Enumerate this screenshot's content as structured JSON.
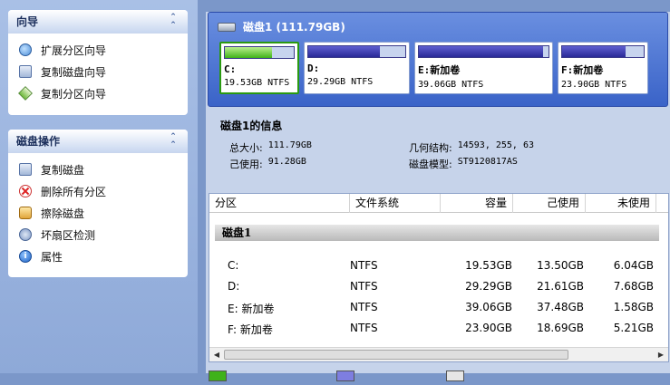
{
  "sidebar": {
    "wizards": {
      "title": "向导",
      "items": [
        {
          "label": "扩展分区向导",
          "icon": "expand-partition-icon"
        },
        {
          "label": "复制磁盘向导",
          "icon": "copy-disk-icon"
        },
        {
          "label": "复制分区向导",
          "icon": "copy-partition-icon"
        }
      ]
    },
    "disk_ops": {
      "title": "磁盘操作",
      "items": [
        {
          "label": "复制磁盘",
          "icon": "copy-disk-icon"
        },
        {
          "label": "删除所有分区",
          "icon": "delete-icon"
        },
        {
          "label": "擦除磁盘",
          "icon": "wipe-disk-icon"
        },
        {
          "label": "坏扇区检测",
          "icon": "bad-sector-icon"
        },
        {
          "label": "属性",
          "icon": "info-icon"
        }
      ]
    }
  },
  "disk": {
    "title": "磁盘1  (111.79GB)",
    "partitions": [
      {
        "name": "C:",
        "size": "19.53GB NTFS",
        "used_fraction": 0.69,
        "color": "#3fb21a"
      },
      {
        "name": "D:",
        "size": "29.29GB NTFS",
        "used_fraction": 0.74,
        "color": "#2a2a98"
      },
      {
        "name": "E:新加卷",
        "size": "39.06GB NTFS",
        "used_fraction": 0.96,
        "color": "#2a2a98"
      },
      {
        "name": "F:新加卷",
        "size": "23.90GB NTFS",
        "used_fraction": 0.78,
        "color": "#2a2a98"
      }
    ]
  },
  "info": {
    "title": "磁盘1的信息",
    "total_label": "总大小:",
    "total_value": "111.79GB",
    "used_label": "己使用:",
    "used_value": "91.28GB",
    "geometry_label": "几何结构:",
    "geometry_value": "14593, 255, 63",
    "model_label": "磁盘模型:",
    "model_value": "ST9120817AS"
  },
  "table": {
    "headers": [
      "分区",
      "文件系统",
      "容量",
      "己使用",
      "未使用"
    ],
    "group": "磁盘1",
    "rows": [
      {
        "partition": "C:",
        "fs": "NTFS",
        "capacity": "19.53GB",
        "used": "13.50GB",
        "free": "6.04GB"
      },
      {
        "partition": "D:",
        "fs": "NTFS",
        "capacity": "29.29GB",
        "used": "21.61GB",
        "free": "7.68GB"
      },
      {
        "partition": "E: 新加卷",
        "fs": "NTFS",
        "capacity": "39.06GB",
        "used": "37.48GB",
        "free": "1.58GB"
      },
      {
        "partition": "F: 新加卷",
        "fs": "NTFS",
        "capacity": "23.90GB",
        "used": "18.69GB",
        "free": "5.21GB"
      }
    ]
  },
  "legend": [
    {
      "color": "#3fb21a"
    },
    {
      "color": "#7e7ee0"
    },
    {
      "color": "#e6e6e6"
    }
  ]
}
